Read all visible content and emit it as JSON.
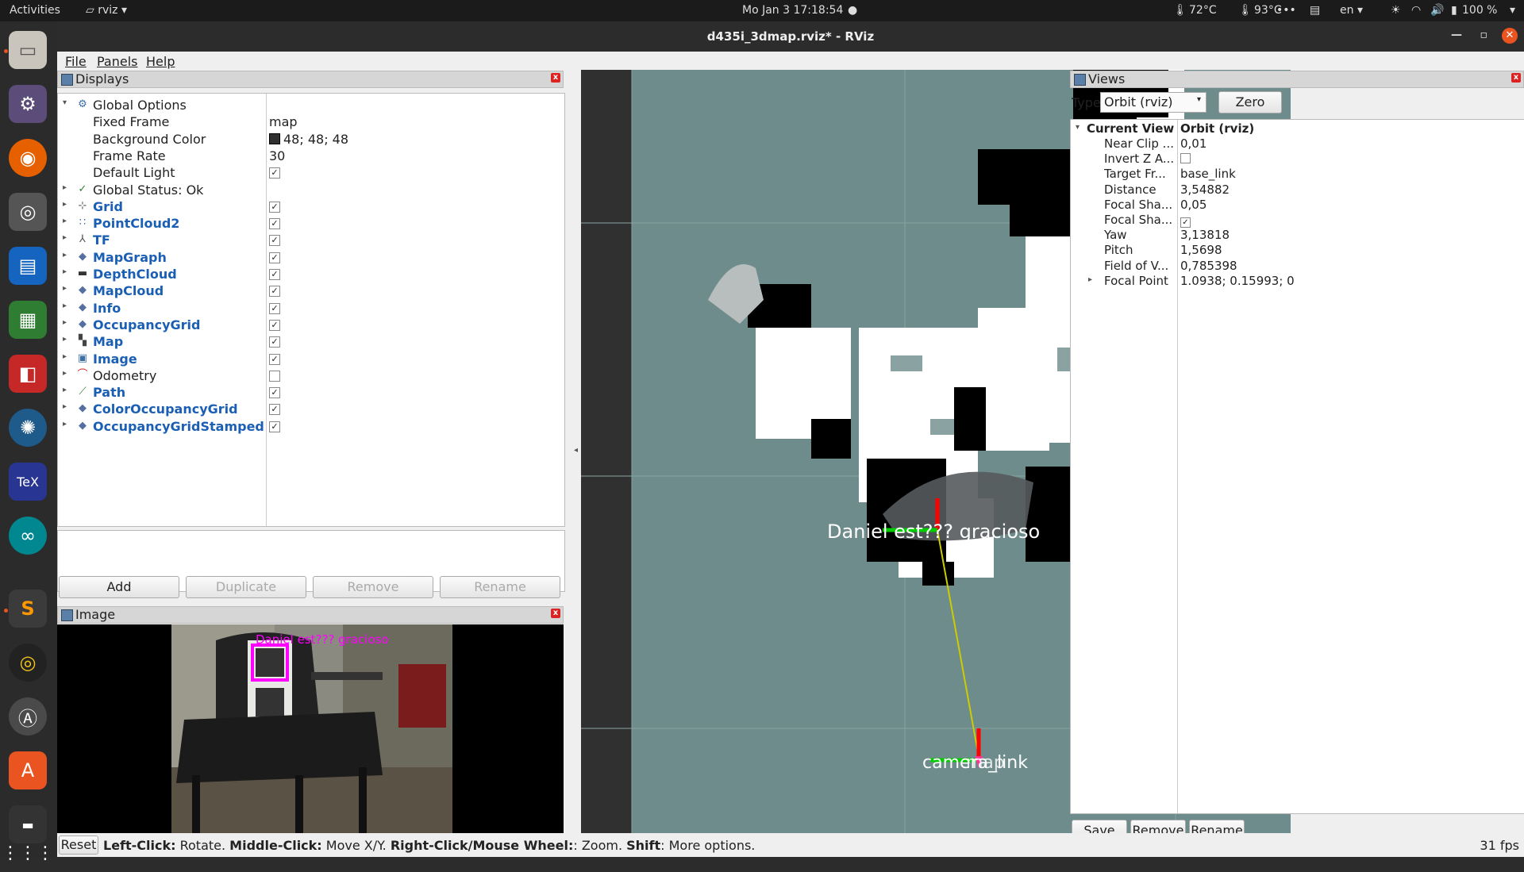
{
  "topbar": {
    "activities": "Activities",
    "app": "rviz",
    "datetime": "Mo Jan 3  17:18:54",
    "temp_cpu": "72°C",
    "temp_gpu": "93°C",
    "dots": "•••",
    "lang": "en",
    "battery": "100 %"
  },
  "dock": {
    "items": [
      "files-icon",
      "settings-icon",
      "firefox-icon",
      "camera-icon",
      "writer-icon",
      "calc-icon",
      "apps-grid-icon",
      "blender-icon",
      "tex-icon",
      "arduino-icon",
      "sublime-icon",
      "rhythmbox-icon",
      "app-center-icon",
      "software-icon",
      "dvd-icon",
      "show-apps-icon"
    ]
  },
  "window": {
    "title": "d435i_3dmap.rviz* - RViz",
    "menu": {
      "file": "File",
      "panels": "Panels",
      "help": "Help"
    }
  },
  "displays": {
    "title": "Displays",
    "rows": [
      {
        "label": "Global Options",
        "value": "",
        "icon": "globe",
        "level": 0,
        "expand": "▾",
        "blue": false
      },
      {
        "label": "Fixed Frame",
        "value": "map",
        "level": 1,
        "blue": false
      },
      {
        "label": "Background Color",
        "value": "48; 48; 48",
        "level": 1,
        "blue": false
      },
      {
        "label": "Frame Rate",
        "value": "30",
        "level": 1,
        "blue": false
      },
      {
        "label": "Default Light",
        "value": "",
        "level": 1,
        "blue": false
      },
      {
        "label": "Global Status: Ok",
        "value": "",
        "icon": "check",
        "level": 0,
        "expand": "▸",
        "blue": false
      },
      {
        "label": "Grid",
        "icon": "grid",
        "level": 0,
        "expand": "▸",
        "blue": true
      },
      {
        "label": "PointCloud2",
        "icon": "cloud",
        "level": 0,
        "expand": "▸",
        "blue": true
      },
      {
        "label": "TF",
        "icon": "axes",
        "level": 0,
        "expand": "▸",
        "blue": true
      },
      {
        "label": "MapGraph",
        "icon": "diamond",
        "level": 0,
        "expand": "▸",
        "blue": true
      },
      {
        "label": "DepthCloud",
        "icon": "camera",
        "level": 0,
        "expand": "▸",
        "blue": true
      },
      {
        "label": "MapCloud",
        "icon": "diamond",
        "level": 0,
        "expand": "▸",
        "blue": true
      },
      {
        "label": "Info",
        "icon": "diamond",
        "level": 0,
        "expand": "▸",
        "blue": true
      },
      {
        "label": "OccupancyGrid",
        "icon": "diamond",
        "level": 0,
        "expand": "▸",
        "blue": true
      },
      {
        "label": "Map",
        "icon": "map",
        "level": 0,
        "expand": "▸",
        "blue": true
      },
      {
        "label": "Image",
        "icon": "image",
        "level": 0,
        "expand": "▸",
        "blue": true
      },
      {
        "label": "Odometry",
        "icon": "odom",
        "level": 0,
        "expand": "▸",
        "blue": false
      },
      {
        "label": "Path",
        "icon": "path",
        "level": 0,
        "expand": "▸",
        "blue": true
      },
      {
        "label": "ColorOccupancyGrid",
        "icon": "diamond",
        "level": 0,
        "expand": "▸",
        "blue": true
      },
      {
        "label": "OccupancyGridStamped",
        "icon": "diamond",
        "level": 0,
        "expand": "▸",
        "blue": true
      }
    ],
    "checked": {
      "Default Light": true,
      "Grid": true,
      "PointCloud2": true,
      "TF": true,
      "MapGraph": true,
      "DepthCloud": true,
      "MapCloud": true,
      "Info": true,
      "OccupancyGrid": true,
      "Map": true,
      "Image": true,
      "Odometry": false,
      "Path": true,
      "ColorOccupancyGrid": true,
      "OccupancyGridStamped": true
    },
    "buttons": {
      "add": "Add",
      "duplicate": "Duplicate",
      "remove": "Remove",
      "rename": "Rename"
    }
  },
  "image_panel": {
    "title": "Image",
    "overlay_text": "Daniel est??? gracioso"
  },
  "viewport": {
    "marker_text": "Daniel est??? gracioso",
    "frame_label_1": "camera_link",
    "frame_label_2": "map"
  },
  "views": {
    "title": "Views",
    "type_label": "Type:",
    "type_value": "Orbit (rviz)",
    "zero": "Zero",
    "current_view": {
      "label": "Current View",
      "value": "Orbit (rviz)"
    },
    "props": [
      {
        "label": "Near Clip ...",
        "value": "0,01"
      },
      {
        "label": "Invert Z A...",
        "value": "",
        "checkbox": false
      },
      {
        "label": "Target Fr...",
        "value": "base_link"
      },
      {
        "label": "Distance",
        "value": "3,54882"
      },
      {
        "label": "Focal Sha...",
        "value": "0,05"
      },
      {
        "label": "Focal Sha...",
        "value": "",
        "checkbox": true
      },
      {
        "label": "Yaw",
        "value": "3,13818"
      },
      {
        "label": "Pitch",
        "value": "1,5698"
      },
      {
        "label": "Field of V...",
        "value": "0,785398"
      },
      {
        "label": "Focal Point",
        "value": "1.0938; 0.15993; 0"
      }
    ],
    "buttons": {
      "save": "Save",
      "remove": "Remove",
      "rename": "Rename"
    }
  },
  "status": {
    "reset": "Reset",
    "left_click": "Left-Click:",
    "left_click_desc": " Rotate. ",
    "middle_click": "Middle-Click:",
    "middle_click_desc": " Move X/Y. ",
    "right_click": "Right-Click/Mouse Wheel:",
    "right_click_desc": ": Zoom. ",
    "shift": "Shift",
    "shift_desc": ": More options.",
    "fps": "31 fps"
  },
  "colors": {
    "accent": "#e95420",
    "blue_label": "#1b5fb4",
    "viewport_bg": "#6e8c8b"
  }
}
